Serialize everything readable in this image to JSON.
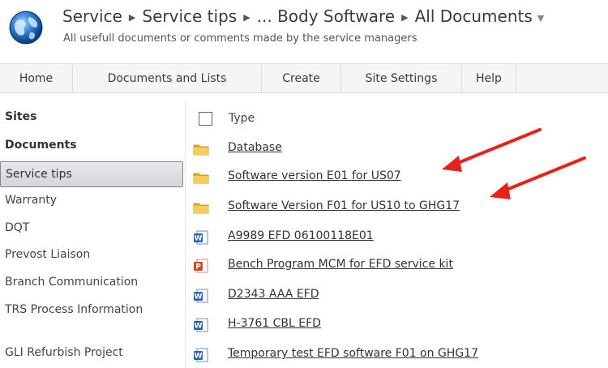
{
  "header": {
    "breadcrumb": [
      "Service",
      "Service tips",
      "... Body Software",
      "All Documents"
    ],
    "description": "All usefull documents or comments made by the service managers"
  },
  "topnav": {
    "items": [
      "Home",
      "Documents and Lists",
      "Create",
      "Site Settings",
      "Help"
    ]
  },
  "leftnav": {
    "headings": [
      "Sites",
      "Documents"
    ],
    "items": [
      "Service tips",
      "Warranty",
      "DQT",
      "Prevost Liaison",
      "Branch Communication",
      "TRS Process Information",
      "GLI Refurbish Project"
    ],
    "selected": "Service tips"
  },
  "doclist": {
    "column_header": "Type",
    "rows": [
      {
        "icon": "folder-icon",
        "name": "Database"
      },
      {
        "icon": "folder-icon",
        "name": "Software version E01 for US07"
      },
      {
        "icon": "folder-icon",
        "name": "Software Version F01 for US10 to GHG17"
      },
      {
        "icon": "word-doc-icon",
        "name": "A9989 EFD 06100118E01"
      },
      {
        "icon": "powerpoint-doc-icon",
        "name": "Bench Program MCM for EFD service kit"
      },
      {
        "icon": "word-doc-icon",
        "name": "D2343 AAA EFD"
      },
      {
        "icon": "word-doc-icon",
        "name": "H-3761 CBL EFD"
      },
      {
        "icon": "word-doc-icon",
        "name": "Temporary test EFD software F01 on GHG17"
      }
    ]
  },
  "annotations": {
    "arrow_color": "#e8221b",
    "arrow_targets": [
      "Software version E01 for US07",
      "Software Version F01 for US10 to GHG17"
    ]
  },
  "colors": {
    "folder": "#e9b93c",
    "word_icon": "#2b63b8",
    "ppt_icon": "#d24726",
    "selected_nav": "#d8dadf"
  }
}
